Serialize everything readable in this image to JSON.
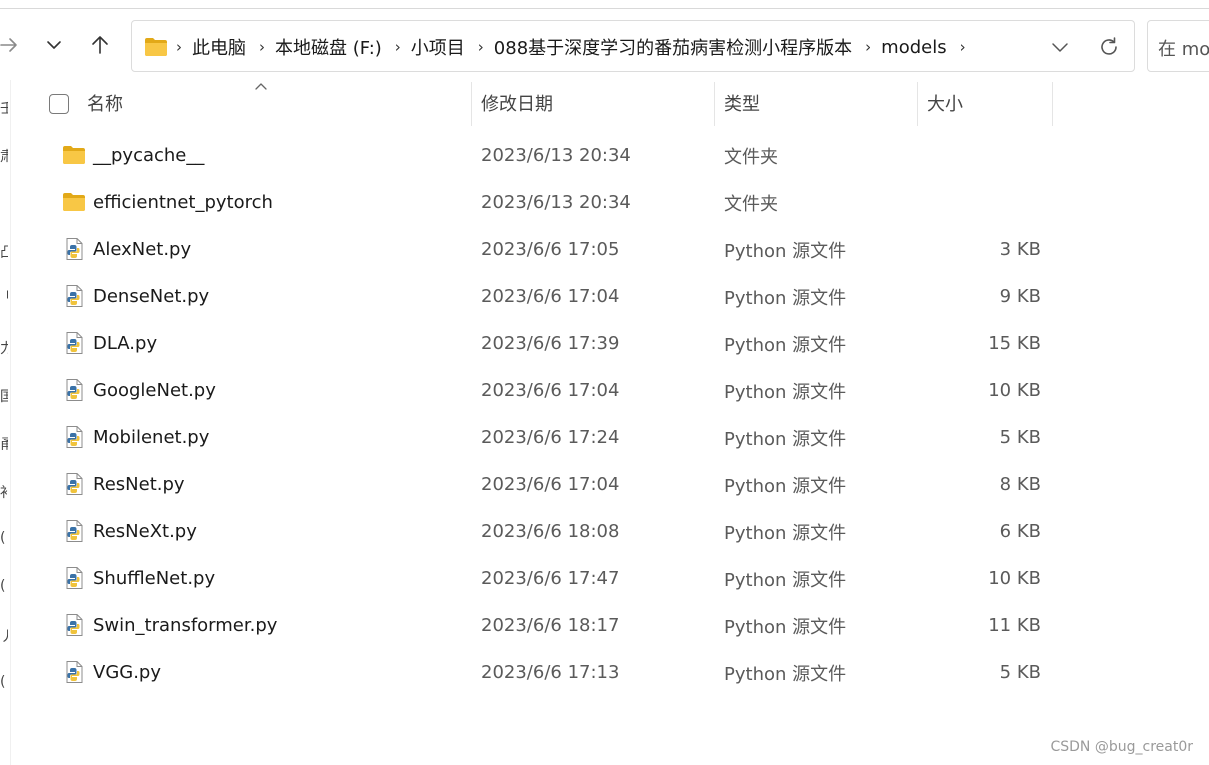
{
  "toolbar": {
    "forward_icon": "arrow-right-icon",
    "recent_icon": "chevron-down-icon",
    "up_icon": "arrow-up-icon"
  },
  "address_bar": {
    "folder_icon": "folder-icon",
    "crumbs": [
      "此电脑",
      "本地磁盘 (F:)",
      "小项目",
      "088基于深度学习的番茄病害检测小程序版本",
      "models"
    ],
    "separator": "›",
    "dropdown_icon": "chevron-down-icon",
    "refresh_icon": "refresh-icon"
  },
  "search": {
    "placeholder": "在 models 中搜索",
    "visible_text": "在 mo"
  },
  "left_pane": {
    "fragments": [
      "壬",
      "肃",
      "凸",
      "刂",
      "力",
      "国",
      "甬",
      "补",
      "(",
      "(",
      "丿",
      "("
    ]
  },
  "columns": {
    "name": "名称",
    "date": "修改日期",
    "type": "类型",
    "size": "大小"
  },
  "colors": {
    "folder": "#f8c745",
    "folder_dark": "#e2a918",
    "python_blue": "#3a72a8",
    "python_yellow": "#f0c33c"
  },
  "files": [
    {
      "name": "__pycache__",
      "date": "2023/6/13 20:34",
      "type": "文件夹",
      "size": "",
      "icon": "folder-icon"
    },
    {
      "name": "efficientnet_pytorch",
      "date": "2023/6/13 20:34",
      "type": "文件夹",
      "size": "",
      "icon": "folder-icon"
    },
    {
      "name": "AlexNet.py",
      "date": "2023/6/6 17:05",
      "type": "Python 源文件",
      "size": "3 KB",
      "icon": "python-file-icon"
    },
    {
      "name": "DenseNet.py",
      "date": "2023/6/6 17:04",
      "type": "Python 源文件",
      "size": "9 KB",
      "icon": "python-file-icon"
    },
    {
      "name": "DLA.py",
      "date": "2023/6/6 17:39",
      "type": "Python 源文件",
      "size": "15 KB",
      "icon": "python-file-icon"
    },
    {
      "name": "GoogleNet.py",
      "date": "2023/6/6 17:04",
      "type": "Python 源文件",
      "size": "10 KB",
      "icon": "python-file-icon"
    },
    {
      "name": "Mobilenet.py",
      "date": "2023/6/6 17:24",
      "type": "Python 源文件",
      "size": "5 KB",
      "icon": "python-file-icon"
    },
    {
      "name": "ResNet.py",
      "date": "2023/6/6 17:04",
      "type": "Python 源文件",
      "size": "8 KB",
      "icon": "python-file-icon"
    },
    {
      "name": "ResNeXt.py",
      "date": "2023/6/6 18:08",
      "type": "Python 源文件",
      "size": "6 KB",
      "icon": "python-file-icon"
    },
    {
      "name": "ShuffleNet.py",
      "date": "2023/6/6 17:47",
      "type": "Python 源文件",
      "size": "10 KB",
      "icon": "python-file-icon"
    },
    {
      "name": "Swin_transformer.py",
      "date": "2023/6/6 18:17",
      "type": "Python 源文件",
      "size": "11 KB",
      "icon": "python-file-icon"
    },
    {
      "name": "VGG.py",
      "date": "2023/6/6 17:13",
      "type": "Python 源文件",
      "size": "5 KB",
      "icon": "python-file-icon"
    }
  ],
  "watermark": "CSDN @bug_creat0r"
}
